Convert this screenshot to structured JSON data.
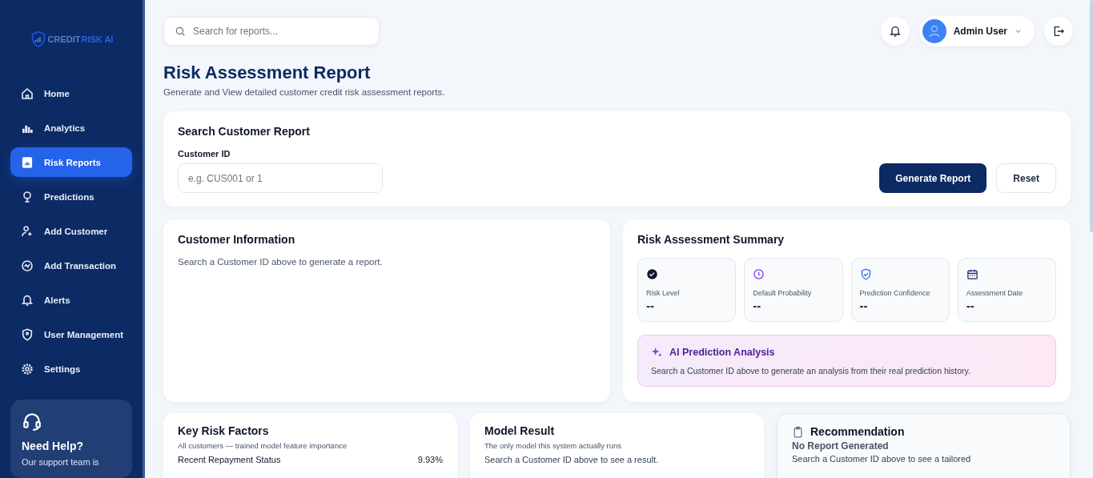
{
  "sidebar": {
    "logo": {
      "part_1": "CREDIT",
      "part_2": "RISK AI"
    },
    "items": [
      {
        "label": "Home",
        "selected": false
      },
      {
        "label": "Analytics",
        "selected": false
      },
      {
        "label": "Risk Reports",
        "selected": true
      },
      {
        "label": "Predictions",
        "selected": false
      },
      {
        "label": "Add Customer",
        "selected": false
      },
      {
        "label": "Add Transaction",
        "selected": false
      },
      {
        "label": "Alerts",
        "selected": false
      },
      {
        "label": "User Management",
        "selected": false
      },
      {
        "label": "Settings",
        "selected": false
      }
    ],
    "help": {
      "title": "Need Help?",
      "text": "Our support team is"
    }
  },
  "topbar": {
    "search": {
      "placeholder": "Search for reports..."
    },
    "user": {
      "name": "Admin User"
    }
  },
  "page": {
    "title": "Risk Assessment Report",
    "subtitle": "Generate and View detailed customer credit risk assessment reports."
  },
  "search_card": {
    "title": "Search Customer Report",
    "field": {
      "label": "Customer ID",
      "placeholder": "e.g. CUS001 or 1"
    },
    "buttons": [
      {
        "label": "Generate Report",
        "kind": "primary"
      },
      {
        "label": "Reset",
        "kind": "secondary"
      }
    ]
  },
  "customer_info": {
    "title": "Customer Information",
    "text": "Search a Customer ID above to generate a report."
  },
  "summary": {
    "title": "Risk Assessment Summary",
    "stats": [
      {
        "label": "Risk Level",
        "value": "--"
      },
      {
        "label": "Default Probability",
        "value": "--"
      },
      {
        "label": "Prediction Confidence",
        "value": "--"
      },
      {
        "label": "Assessment Date",
        "value": "--"
      }
    ],
    "ai": {
      "title": "AI Prediction Analysis",
      "text": "Search a Customer ID above to generate an analysis from their real prediction history."
    }
  },
  "key_risk_factors": {
    "title": "Key Risk Factors",
    "subtitle": "All customers — trained model feature importance",
    "rows": [
      {
        "name": "Recent Repayment Status",
        "value": "9.93%"
      }
    ]
  },
  "model_result": {
    "title": "Model Result",
    "subtitle": "The only model this system actually runs",
    "text": "Search a Customer ID above to see a result."
  },
  "recommendation": {
    "title": "Recommendation",
    "status": "No Report Generated",
    "text": "Search a Customer ID above to see a tailored"
  }
}
